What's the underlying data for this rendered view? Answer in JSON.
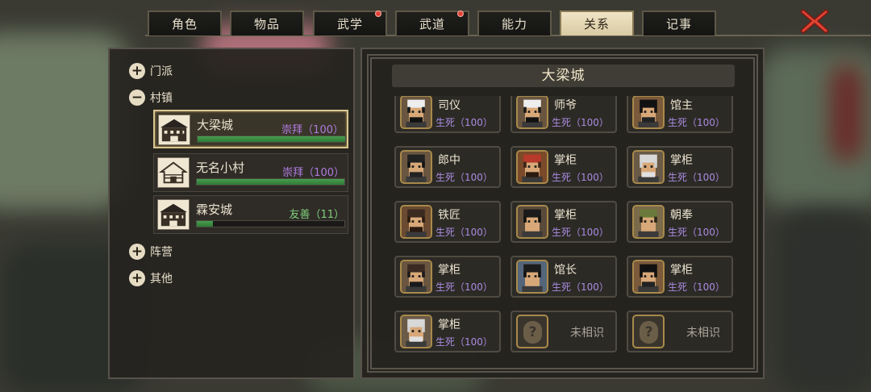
{
  "tabs": [
    {
      "label": "角色",
      "active": false,
      "badge": false
    },
    {
      "label": "物品",
      "active": false,
      "badge": false
    },
    {
      "label": "武学",
      "active": false,
      "badge": true
    },
    {
      "label": "武道",
      "active": false,
      "badge": true
    },
    {
      "label": "能力",
      "active": false,
      "badge": false
    },
    {
      "label": "关系",
      "active": true,
      "badge": false
    },
    {
      "label": "记事",
      "active": false,
      "badge": false
    }
  ],
  "tree": {
    "sect": {
      "label": "门派",
      "expander": "+"
    },
    "village": {
      "label": "村镇",
      "expander": "−"
    },
    "camp": {
      "label": "阵营",
      "expander": "+"
    },
    "other": {
      "label": "其他",
      "expander": "+"
    }
  },
  "villages": [
    {
      "name": "大梁城",
      "status": "崇拜（100）",
      "status_color": "#b07be0",
      "progress": 1.0,
      "selected": true
    },
    {
      "name": "无名小村",
      "status": "崇拜（100）",
      "status_color": "#b07be0",
      "progress": 1.0,
      "selected": false
    },
    {
      "name": "霖安城",
      "status": "友善（11）",
      "status_color": "#7ed07a",
      "progress": 0.11,
      "selected": false
    }
  ],
  "detail": {
    "city_title": "大梁城",
    "npcs": [
      {
        "name": "司仪",
        "relation": "生死（100）",
        "portrait": "hat-white"
      },
      {
        "name": "师爷",
        "relation": "生死（100）",
        "portrait": "hat-white"
      },
      {
        "name": "馆主",
        "relation": "生死（100）",
        "portrait": "bun-black"
      },
      {
        "name": "郎中",
        "relation": "生死（100）",
        "portrait": "cap-black"
      },
      {
        "name": "掌柜",
        "relation": "生死（100）",
        "portrait": "red-cap"
      },
      {
        "name": "掌柜",
        "relation": "生死（100）",
        "portrait": "old-white"
      },
      {
        "name": "铁匠",
        "relation": "生死（100）",
        "portrait": "bandana"
      },
      {
        "name": "掌柜",
        "relation": "生死（100）",
        "portrait": "woman"
      },
      {
        "name": "朝奉",
        "relation": "生死（100）",
        "portrait": "green-cap"
      },
      {
        "name": "掌柜",
        "relation": "生死（100）",
        "portrait": "cap-brown"
      },
      {
        "name": "馆长",
        "relation": "生死（100）",
        "portrait": "hat-black"
      },
      {
        "name": "掌柜",
        "relation": "生死（100）",
        "portrait": "bun-black"
      },
      {
        "name": "掌柜",
        "relation": "生死（100）",
        "portrait": "old-white"
      },
      {
        "name": "",
        "relation": "",
        "unknown": true,
        "unknown_label": "未相识"
      },
      {
        "name": "",
        "relation": "",
        "unknown": true,
        "unknown_label": "未相识"
      }
    ]
  }
}
